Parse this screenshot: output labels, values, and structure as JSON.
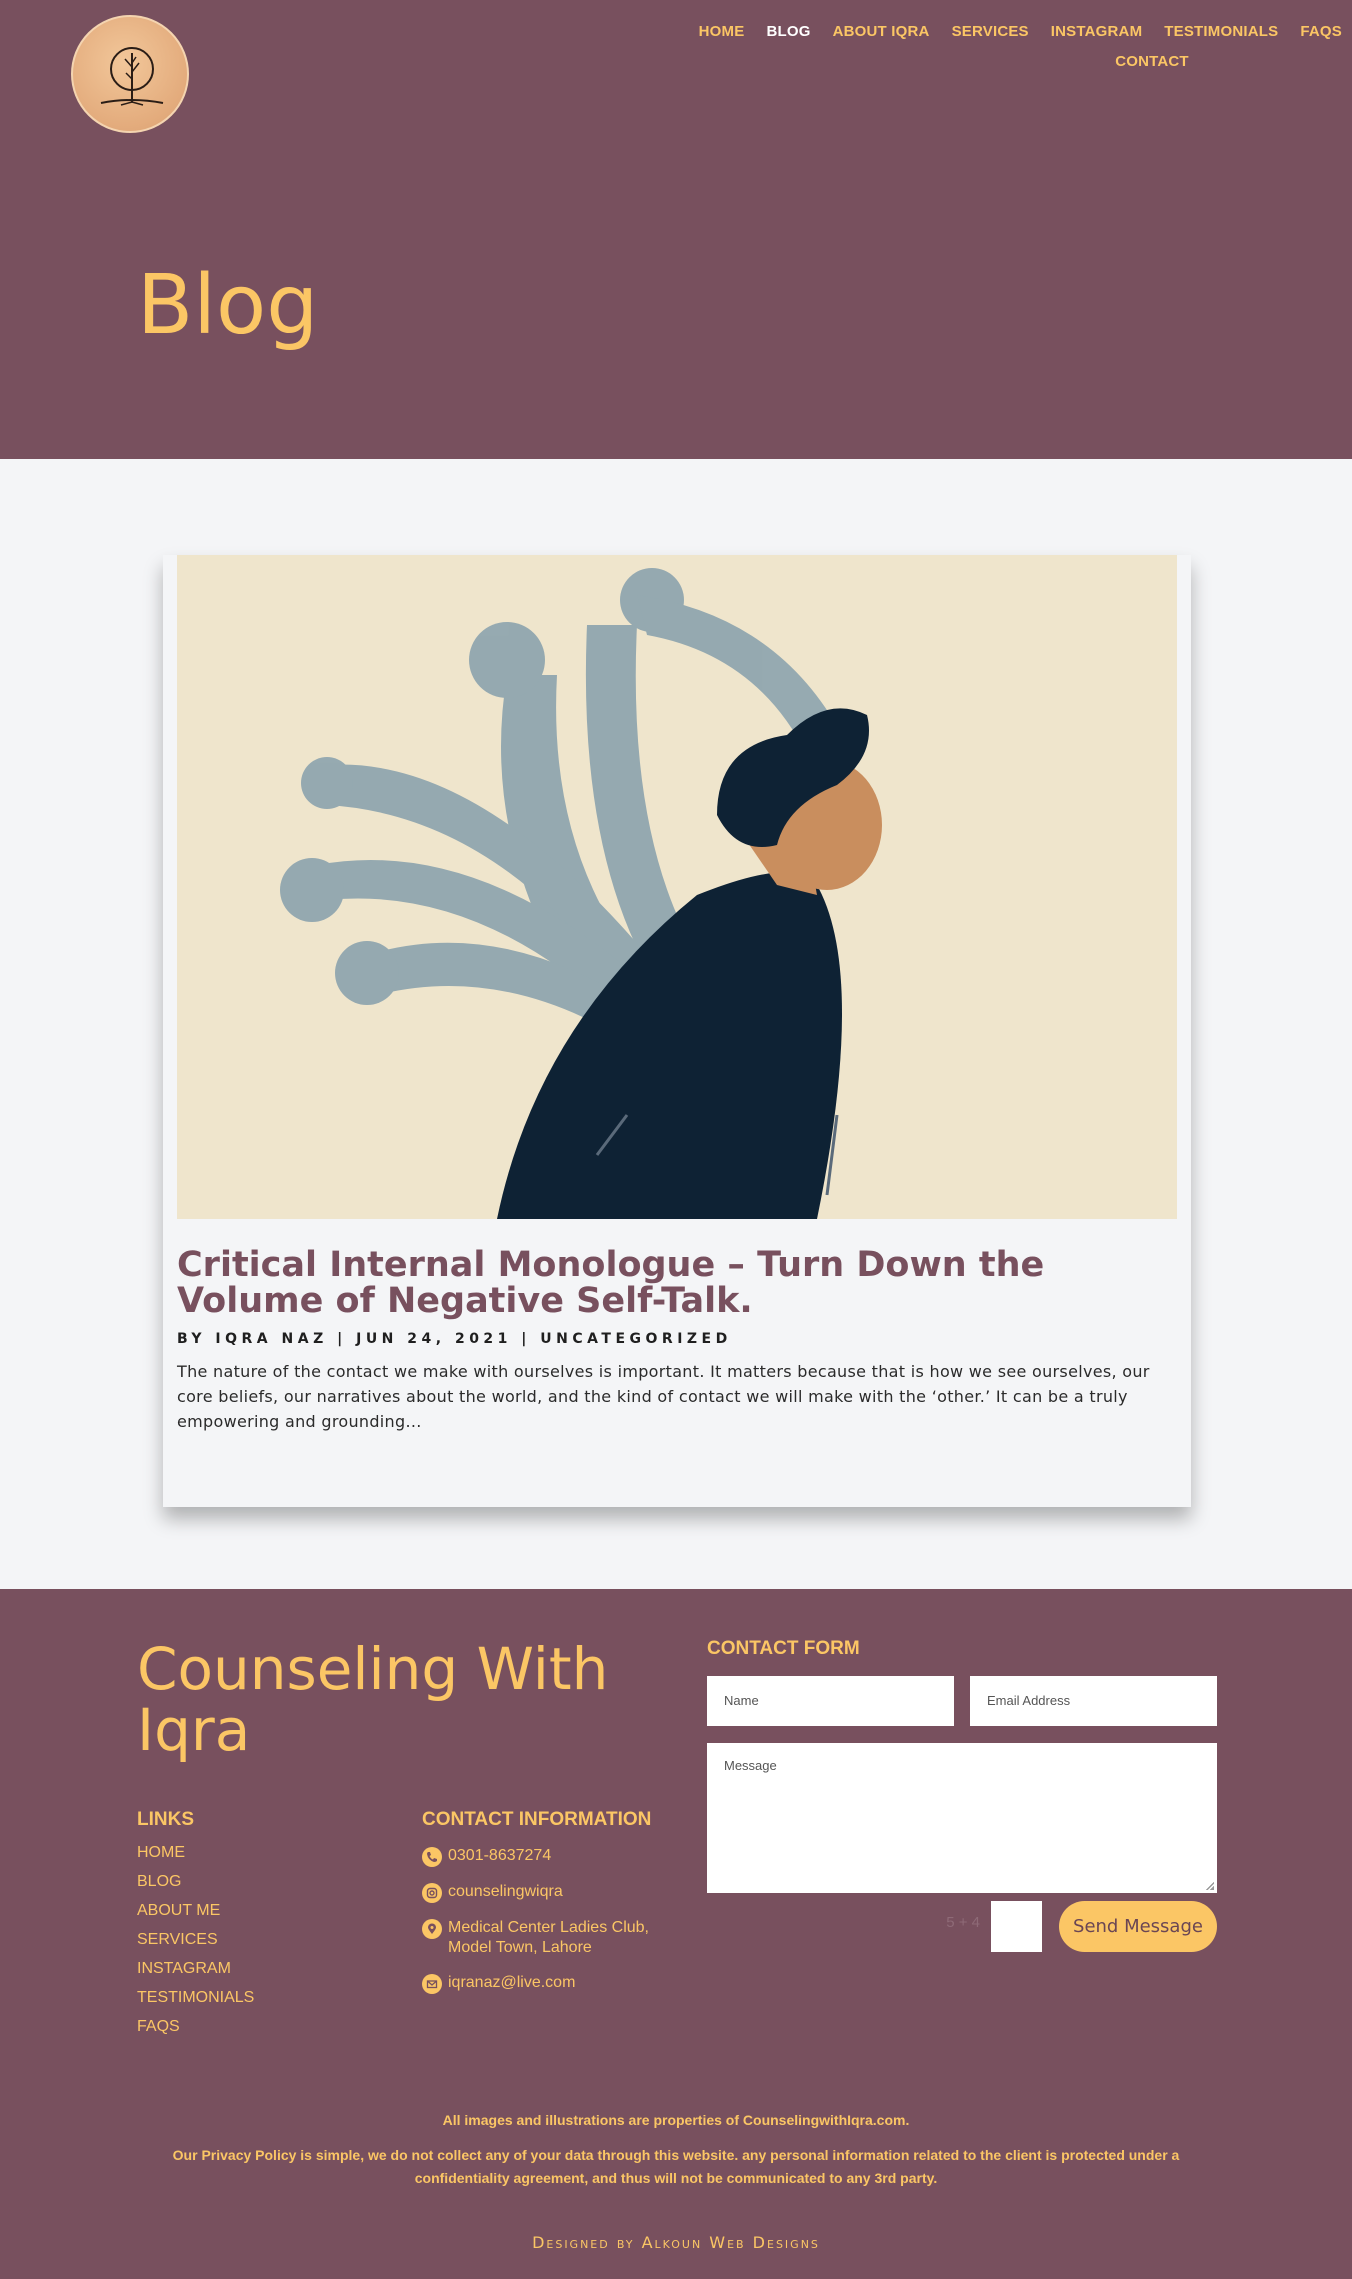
{
  "nav": {
    "items": [
      "HOME",
      "BLOG",
      "ABOUT IQRA",
      "SERVICES",
      "INSTAGRAM",
      "TESTIMONIALS",
      "FAQS"
    ],
    "items_second_row": [
      "CONTACT"
    ],
    "active": "BLOG"
  },
  "hero": {
    "title": "Blog"
  },
  "post": {
    "title": "Critical Internal Monologue – Turn Down the Volume of Negative Self-Talk.",
    "meta": {
      "author": "BY IQRA NAZ",
      "sep1": "|",
      "date": "JUN 24, 2021",
      "sep2": "|",
      "category": "UNCATEGORIZED"
    },
    "excerpt": "The nature of the contact we make with ourselves is important. It matters because that is how we see ourselves, our core beliefs, our narratives about the world, and the kind of contact we will make with the ‘other.’ It can be a truly empowering and grounding..."
  },
  "footer": {
    "brand": "Counseling With Iqra",
    "links_heading": "LINKS",
    "links": [
      "HOME",
      "BLOG",
      "ABOUT ME",
      "SERVICES",
      "INSTAGRAM",
      "TESTIMONIALS",
      "FAQS"
    ],
    "contact_heading": "CONTACT INFORMATION",
    "contact": {
      "phone": "0301-8637274",
      "instagram": "counselingwiqra",
      "address": "Medical Center Ladies Club, Model Town, Lahore",
      "email": "iqranaz@live.com"
    },
    "form": {
      "heading": "CONTACT FORM",
      "name_placeholder": "Name",
      "email_placeholder": "Email Address",
      "message_placeholder": "Message",
      "captcha_label": "5 + 4",
      "send_label": "Send Message"
    },
    "notice_images": "All images and illustrations are properties of CounselingwithIqra.com.",
    "notice_privacy": "Our Privacy Policy is simple, we do not collect any of your data through this website. any personal information related to the client is protected under a confidentiality agreement, and thus will not be communicated to any 3rd party.",
    "credit": "Designed by Alkoun Web Designs"
  },
  "colors": {
    "brand_plum": "#78505e",
    "accent_gold": "#fbc665",
    "page_bg": "#f4f5f7"
  }
}
